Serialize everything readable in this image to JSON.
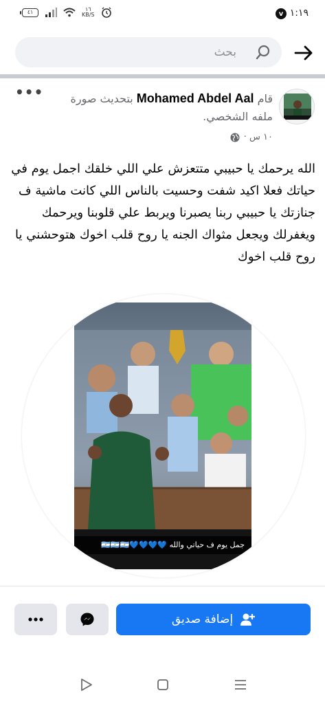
{
  "status_bar": {
    "time": "١:١٩",
    "notification_badge": "v",
    "battery": "٤١",
    "network_speed_value": "١٦",
    "network_speed_unit": "KB/S"
  },
  "search": {
    "placeholder": "بحث"
  },
  "post": {
    "author": "Mohamed Abdel Aal",
    "action_prefix": "قام",
    "action_text": "بتحديث صورة ملفه الشخصي.",
    "timestamp": "١٠ س ·",
    "privacy_icon": "globe-icon",
    "body": "الله يرحمك يا حبيبي متتعزش علي اللي خلقك اجمل يوم في حياتك فعلا اكيد شفت وحسيت بالناس اللي كانت ماشية ف جنازتك يا حبيبي ربنا يصبرنا ويربط علي قلوبنا ويرحمك ويغفرلك ويجعل مثواك الجنه يا روح قلب اخوك هتوحشني يا روح قلب اخوك",
    "photo_caption": "جمل يوم ف حياتي والله 💙💙💙💙🇦🇷🇦🇷🇦🇷"
  },
  "actions": {
    "add_friend_label": "إضافة صديق",
    "messenger_icon": "messenger-icon",
    "more_icon": "more-icon"
  },
  "colors": {
    "primary_blue": "#1877f2",
    "secondary_button": "#e4e6eb",
    "search_background": "#f0f2f5"
  }
}
